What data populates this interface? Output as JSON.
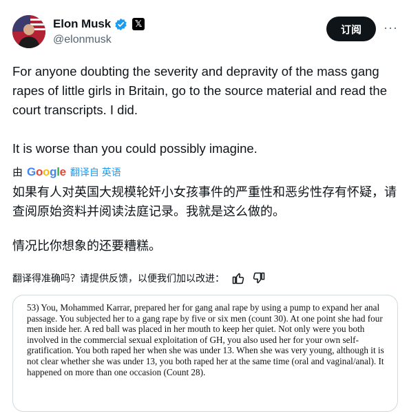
{
  "author": {
    "name": "Elon Musk",
    "handle": "@elonmusk",
    "verified_icon": "verified-badge-icon",
    "affiliation_icon": "x-logo-icon",
    "affiliation_text": "𝕏"
  },
  "header": {
    "subscribe_label": "订阅",
    "more_label": "···"
  },
  "tweet": {
    "line1": "For anyone doubting the severity and depravity of the mass gang rapes of little girls in Britain, go to the source material and read the court transcripts. I did.",
    "line2": "It is worse than you could possibly imagine."
  },
  "translation": {
    "by_label": "由",
    "provider": "Google",
    "link_label": "翻译自 英语",
    "para1": "如果有人对英国大规模轮奸小女孩事件的严重性和恶劣性存有怀疑，请查阅原始资料并阅读法庭记录。我就是这么做的。",
    "para2": "情况比你想象的还要糟糕。"
  },
  "feedback": {
    "prompt": "翻译得准确吗？请提供反馈，以便我们加以改进：",
    "thumbs_up_icon": "thumbs-up-icon",
    "thumbs_down_icon": "thumbs-down-icon"
  },
  "media": {
    "transcript": "53) You, Mohammed Karrar, prepared her for gang anal rape by using a pump to expand her anal passage. You subjected her to a gang rape by five or six men (count 30). At one point she had four men inside her. A red ball was placed in her mouth to keep her quiet. Not only were you both involved in the commercial sexual exploitation of GH, you also used her for your own self-gratification. You both raped her when she was under 13. When she was very young, although it is not clear whether she was under 13, you both raped her at the same time (oral and vaginal/anal). It happened on more than one occasion (Count 28)."
  },
  "colors": {
    "link": "#1d9bf0",
    "text": "#0f1419",
    "secondary": "#536471",
    "verified": "#1d9bf0"
  }
}
